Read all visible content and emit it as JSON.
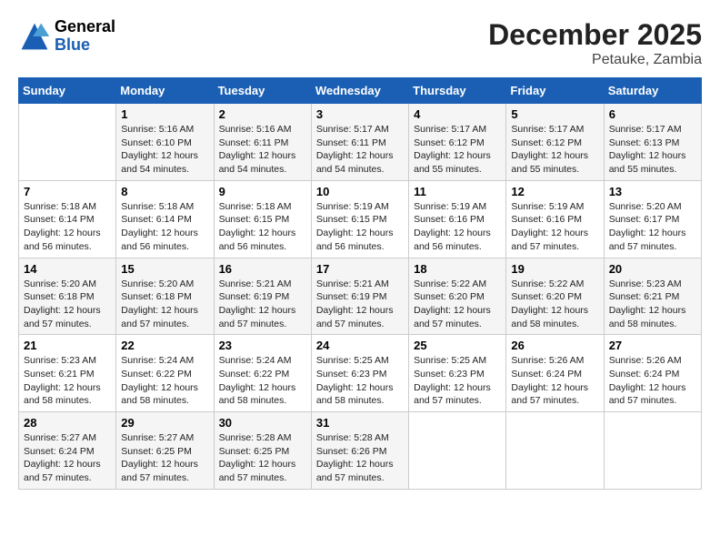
{
  "header": {
    "logo_general": "General",
    "logo_blue": "Blue",
    "month_year": "December 2025",
    "location": "Petauke, Zambia"
  },
  "weekdays": [
    "Sunday",
    "Monday",
    "Tuesday",
    "Wednesday",
    "Thursday",
    "Friday",
    "Saturday"
  ],
  "weeks": [
    [
      {
        "day": "",
        "info": ""
      },
      {
        "day": "1",
        "info": "Sunrise: 5:16 AM\nSunset: 6:10 PM\nDaylight: 12 hours\nand 54 minutes."
      },
      {
        "day": "2",
        "info": "Sunrise: 5:16 AM\nSunset: 6:11 PM\nDaylight: 12 hours\nand 54 minutes."
      },
      {
        "day": "3",
        "info": "Sunrise: 5:17 AM\nSunset: 6:11 PM\nDaylight: 12 hours\nand 54 minutes."
      },
      {
        "day": "4",
        "info": "Sunrise: 5:17 AM\nSunset: 6:12 PM\nDaylight: 12 hours\nand 55 minutes."
      },
      {
        "day": "5",
        "info": "Sunrise: 5:17 AM\nSunset: 6:12 PM\nDaylight: 12 hours\nand 55 minutes."
      },
      {
        "day": "6",
        "info": "Sunrise: 5:17 AM\nSunset: 6:13 PM\nDaylight: 12 hours\nand 55 minutes."
      }
    ],
    [
      {
        "day": "7",
        "info": "Sunrise: 5:18 AM\nSunset: 6:14 PM\nDaylight: 12 hours\nand 56 minutes."
      },
      {
        "day": "8",
        "info": "Sunrise: 5:18 AM\nSunset: 6:14 PM\nDaylight: 12 hours\nand 56 minutes."
      },
      {
        "day": "9",
        "info": "Sunrise: 5:18 AM\nSunset: 6:15 PM\nDaylight: 12 hours\nand 56 minutes."
      },
      {
        "day": "10",
        "info": "Sunrise: 5:19 AM\nSunset: 6:15 PM\nDaylight: 12 hours\nand 56 minutes."
      },
      {
        "day": "11",
        "info": "Sunrise: 5:19 AM\nSunset: 6:16 PM\nDaylight: 12 hours\nand 56 minutes."
      },
      {
        "day": "12",
        "info": "Sunrise: 5:19 AM\nSunset: 6:16 PM\nDaylight: 12 hours\nand 57 minutes."
      },
      {
        "day": "13",
        "info": "Sunrise: 5:20 AM\nSunset: 6:17 PM\nDaylight: 12 hours\nand 57 minutes."
      }
    ],
    [
      {
        "day": "14",
        "info": "Sunrise: 5:20 AM\nSunset: 6:18 PM\nDaylight: 12 hours\nand 57 minutes."
      },
      {
        "day": "15",
        "info": "Sunrise: 5:20 AM\nSunset: 6:18 PM\nDaylight: 12 hours\nand 57 minutes."
      },
      {
        "day": "16",
        "info": "Sunrise: 5:21 AM\nSunset: 6:19 PM\nDaylight: 12 hours\nand 57 minutes."
      },
      {
        "day": "17",
        "info": "Sunrise: 5:21 AM\nSunset: 6:19 PM\nDaylight: 12 hours\nand 57 minutes."
      },
      {
        "day": "18",
        "info": "Sunrise: 5:22 AM\nSunset: 6:20 PM\nDaylight: 12 hours\nand 57 minutes."
      },
      {
        "day": "19",
        "info": "Sunrise: 5:22 AM\nSunset: 6:20 PM\nDaylight: 12 hours\nand 58 minutes."
      },
      {
        "day": "20",
        "info": "Sunrise: 5:23 AM\nSunset: 6:21 PM\nDaylight: 12 hours\nand 58 minutes."
      }
    ],
    [
      {
        "day": "21",
        "info": "Sunrise: 5:23 AM\nSunset: 6:21 PM\nDaylight: 12 hours\nand 58 minutes."
      },
      {
        "day": "22",
        "info": "Sunrise: 5:24 AM\nSunset: 6:22 PM\nDaylight: 12 hours\nand 58 minutes."
      },
      {
        "day": "23",
        "info": "Sunrise: 5:24 AM\nSunset: 6:22 PM\nDaylight: 12 hours\nand 58 minutes."
      },
      {
        "day": "24",
        "info": "Sunrise: 5:25 AM\nSunset: 6:23 PM\nDaylight: 12 hours\nand 58 minutes."
      },
      {
        "day": "25",
        "info": "Sunrise: 5:25 AM\nSunset: 6:23 PM\nDaylight: 12 hours\nand 57 minutes."
      },
      {
        "day": "26",
        "info": "Sunrise: 5:26 AM\nSunset: 6:24 PM\nDaylight: 12 hours\nand 57 minutes."
      },
      {
        "day": "27",
        "info": "Sunrise: 5:26 AM\nSunset: 6:24 PM\nDaylight: 12 hours\nand 57 minutes."
      }
    ],
    [
      {
        "day": "28",
        "info": "Sunrise: 5:27 AM\nSunset: 6:24 PM\nDaylight: 12 hours\nand 57 minutes."
      },
      {
        "day": "29",
        "info": "Sunrise: 5:27 AM\nSunset: 6:25 PM\nDaylight: 12 hours\nand 57 minutes."
      },
      {
        "day": "30",
        "info": "Sunrise: 5:28 AM\nSunset: 6:25 PM\nDaylight: 12 hours\nand 57 minutes."
      },
      {
        "day": "31",
        "info": "Sunrise: 5:28 AM\nSunset: 6:26 PM\nDaylight: 12 hours\nand 57 minutes."
      },
      {
        "day": "",
        "info": ""
      },
      {
        "day": "",
        "info": ""
      },
      {
        "day": "",
        "info": ""
      }
    ]
  ]
}
